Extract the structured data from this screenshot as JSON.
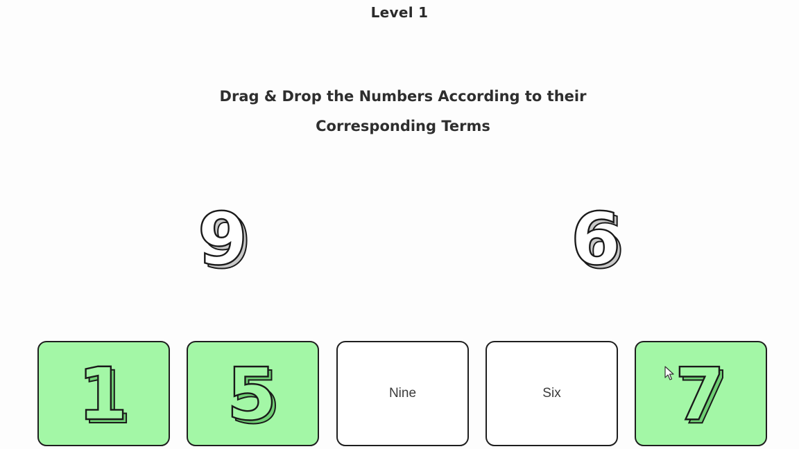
{
  "header": {
    "level_label": "Level 1"
  },
  "instruction": {
    "line1": "Drag & Drop the Numbers According to their",
    "line2": "Corresponding Terms"
  },
  "draggables": [
    {
      "digit": "9"
    },
    {
      "digit": "6"
    }
  ],
  "slots": [
    {
      "state": "filled",
      "digit": "1"
    },
    {
      "state": "filled",
      "digit": "5"
    },
    {
      "state": "empty",
      "term": "Nine"
    },
    {
      "state": "empty",
      "term": "Six"
    },
    {
      "state": "filled",
      "digit": "7"
    }
  ],
  "colors": {
    "filled_slot": "#a3f7a6",
    "empty_slot": "#ffffff",
    "border": "#1e1e1e",
    "text": "#2b2b2b"
  }
}
